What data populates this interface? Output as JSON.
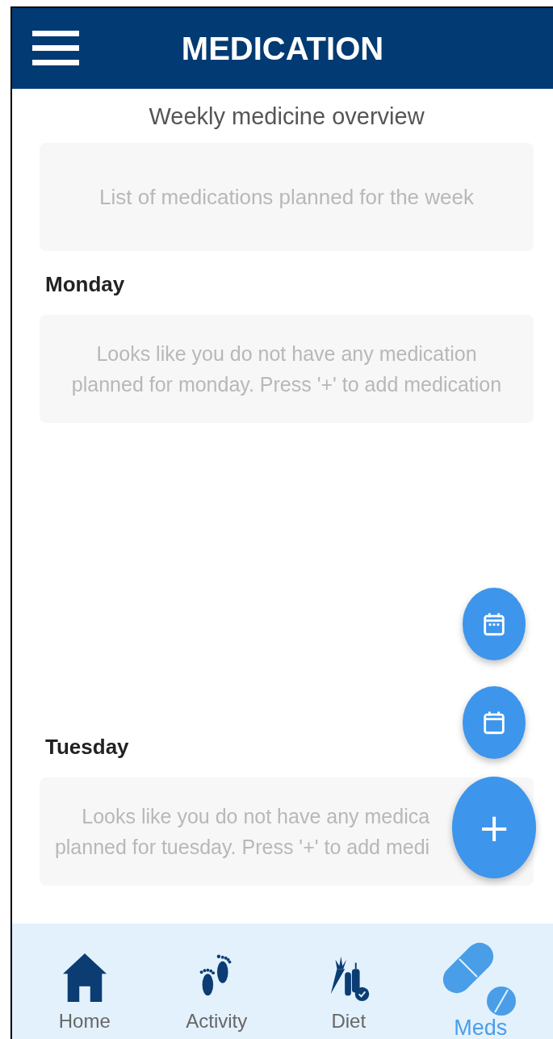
{
  "header": {
    "title": "MEDICATION"
  },
  "subtitle": "Weekly medicine overview",
  "overview": {
    "message": "List of medications planned for the week"
  },
  "days": [
    {
      "label": "Monday",
      "message_lines": [
        "Looks like you do not have any medication",
        "planned for monday. Press '+' to add medication"
      ]
    },
    {
      "label": "Tuesday",
      "message_lines": [
        "Looks like you do not have any medica",
        "planned for tuesday. Press '+' to add medi"
      ]
    }
  ],
  "fab_add": {
    "label": "+"
  },
  "nav": [
    {
      "label": "Home",
      "kind": "home",
      "selected": false
    },
    {
      "label": "Activity",
      "kind": "activity",
      "selected": false
    },
    {
      "label": "Diet",
      "kind": "diet",
      "selected": false
    },
    {
      "label": "Meds",
      "kind": "meds",
      "selected": true
    }
  ]
}
